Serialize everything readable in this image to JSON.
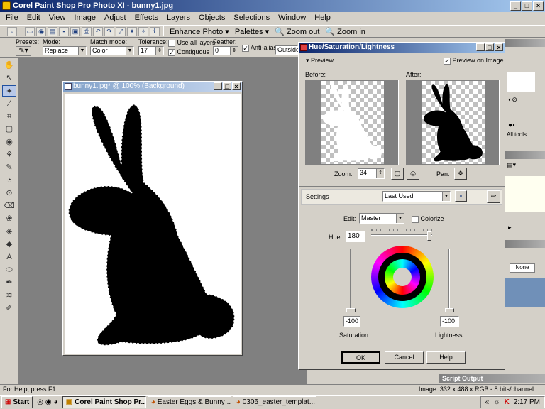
{
  "app": {
    "title": "Corel Paint Shop Pro Photo XI - bunny1.jpg"
  },
  "menu": [
    "File",
    "Edit",
    "View",
    "Image",
    "Adjust",
    "Effects",
    "Layers",
    "Objects",
    "Selections",
    "Window",
    "Help"
  ],
  "toolbar": {
    "enhance_photo": "Enhance Photo",
    "palettes": "Palettes",
    "zoom_out": "Zoom out",
    "zoom_in": "Zoom in"
  },
  "options": {
    "presets_label": "Presets:",
    "mode_label": "Mode:",
    "mode_value": "Replace",
    "match_label": "Match mode:",
    "match_value": "Color",
    "tolerance_label": "Tolerance:",
    "tolerance_value": "17",
    "use_all_layers": "Use all layers",
    "contiguous": "Contiguous",
    "feather_label": "Feather:",
    "feather_value": "0",
    "antialias": "Anti-alias",
    "outside_value": "Outside"
  },
  "document": {
    "title": "bunny1.jpg* @ 100% (Background)"
  },
  "dialog": {
    "title": "Hue/Saturation/Lightness",
    "preview_label": "Preview",
    "preview_on_image": "Preview on Image",
    "before": "Before:",
    "after": "After:",
    "zoom_label": "Zoom:",
    "zoom_value": "34",
    "pan_label": "Pan:",
    "settings_label": "Settings",
    "settings_value": "Last Used",
    "edit_label": "Edit:",
    "edit_value": "Master",
    "colorize": "Colorize",
    "hue_label": "Hue:",
    "hue_value": "180",
    "saturation_value": "-100",
    "lightness_value": "-100",
    "saturation_label": "Saturation:",
    "lightness_label": "Lightness:",
    "ok": "OK",
    "cancel": "Cancel",
    "help": "Help",
    "slider_levels": {
      "hue": 0.99,
      "saturation": 0,
      "lightness": 0
    }
  },
  "right_panel": {
    "all_tools": "All tools",
    "none_label": "None"
  },
  "script_output": "Script Output",
  "status": {
    "left": "For Help, press F1",
    "right": "Image:  332 x 488 x RGB - 8 bits/channel"
  },
  "taskbar": {
    "start": "Start",
    "tasks": [
      "Corel Paint Shop Pr...",
      "Easter Eggs & Bunny ...",
      "0306_easter_templat..."
    ],
    "time": "2:17 PM"
  },
  "colors": {
    "title_dark": "#0a246a",
    "title_light": "#a6caf0",
    "workspace": "#808080",
    "chrome": "#d4d0c8"
  }
}
